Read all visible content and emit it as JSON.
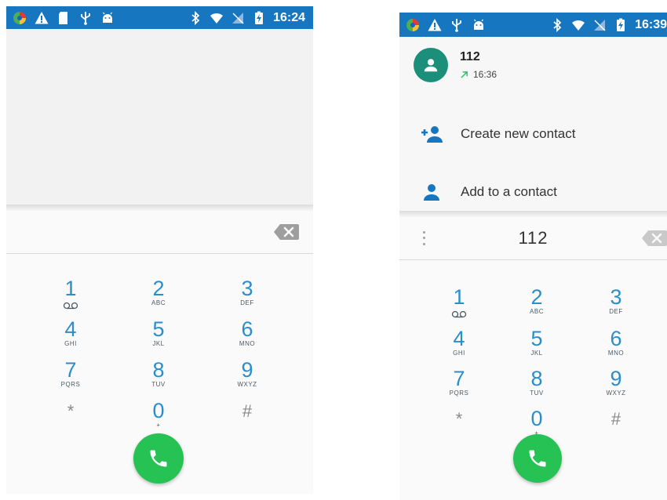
{
  "colors": {
    "status_bar": "#1676c0",
    "accent": "#2a8ecb",
    "call_button": "#27c254",
    "avatar": "#1b8f7a",
    "outgoing_arrow": "#2fbf6a"
  },
  "left_screen": {
    "status": {
      "time": "16:24",
      "left_icons": [
        "maps-icon",
        "warning-icon",
        "sd-card-icon",
        "usb-icon",
        "android-icon"
      ],
      "right_icons": [
        "bluetooth-icon",
        "wifi-icon",
        "no-sim-icon",
        "battery-charging-icon"
      ]
    },
    "dialed_number": ""
  },
  "right_screen": {
    "status": {
      "time": "16:39",
      "left_icons": [
        "maps-icon",
        "warning-icon",
        "usb-icon",
        "android-icon"
      ],
      "right_icons": [
        "bluetooth-icon",
        "wifi-icon",
        "no-sim-icon",
        "battery-charging-icon"
      ]
    },
    "recent_call": {
      "number": "112",
      "time": "16:36",
      "direction_icon": "outgoing-call-arrow-icon"
    },
    "actions": [
      {
        "label": "Create new contact",
        "icon": "add-person-icon"
      },
      {
        "label": "Add to a contact",
        "icon": "person-icon"
      }
    ],
    "dialed_number": "112"
  },
  "keypad": [
    {
      "num": "1",
      "letters": "",
      "voicemail": true
    },
    {
      "num": "2",
      "letters": "ABC"
    },
    {
      "num": "3",
      "letters": "DEF"
    },
    {
      "num": "4",
      "letters": "GHI"
    },
    {
      "num": "5",
      "letters": "JKL"
    },
    {
      "num": "6",
      "letters": "MNO"
    },
    {
      "num": "7",
      "letters": "PQRS"
    },
    {
      "num": "8",
      "letters": "TUV"
    },
    {
      "num": "9",
      "letters": "WXYZ"
    },
    {
      "num": "*",
      "letters": ""
    },
    {
      "num": "0",
      "letters": "+"
    },
    {
      "num": "#",
      "letters": ""
    }
  ]
}
